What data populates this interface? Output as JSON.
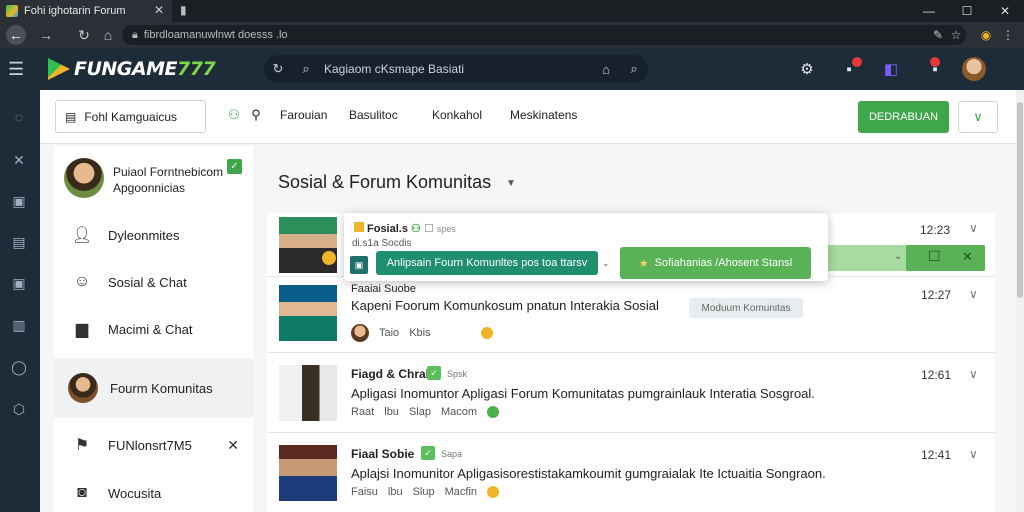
{
  "browser": {
    "tab_title": "Fohi ighotarin Forum",
    "address": "fibrdloamanuwlnwt doesss .lo",
    "new_tab_icon": "plus-icon"
  },
  "app": {
    "logo_prefix": "FUNGAME",
    "logo_suffix": "777",
    "search_placeholder": "Kagiaom cKsmape Basiati"
  },
  "topbar": {
    "category_button": "Fohl Kamguaicus",
    "nav": [
      "Farouian",
      "Basulitoc",
      "Konkahol",
      "Meskinatens"
    ],
    "primary_button": "DEDRABUAN"
  },
  "sidebar": {
    "profile_name": "Puiaol Forntnebicom Apgoonnicias",
    "items": [
      {
        "label": "Dyleonmites"
      },
      {
        "label": "Sosial & Chat"
      },
      {
        "label": "Macimi & Chat"
      },
      {
        "label": "Fourm Komunitas"
      },
      {
        "label": "FUNlonsrt7M5"
      },
      {
        "label": "Wocusita"
      }
    ]
  },
  "content": {
    "title": "Sosial & Forum Komunitas"
  },
  "popup": {
    "title": "Fosial.s",
    "tag": "spes",
    "subtitle": "di.s1a Socdis",
    "button1": "Anlipsain Fourn Komunltes pos toa ttarsv",
    "button2": "Sofiahanias  /Ahosent Stansl"
  },
  "rows": [
    {
      "title": "",
      "tag": "",
      "desc": "",
      "time": "12:23",
      "meta": []
    },
    {
      "title": "Faaiai Suobe",
      "tag": "",
      "desc": "Kapeni Foorum Komunkosum pnatun Interakia Sosial",
      "pill": "Moduum Komunitas",
      "time": "12:27",
      "meta": [
        "Taio",
        "Kbis"
      ]
    },
    {
      "title": "Fiagd & Chral",
      "tag": "Spsk",
      "desc": "Apligasi Inomuntor Apligasi Forum Komunitatas pumgrainlauk Interatia Sosgroal.",
      "time": "12:61",
      "meta": [
        "Raat",
        "lbu",
        "Slap",
        "Macom"
      ]
    },
    {
      "title": "Fiaal Sobie",
      "tag": "Sapa",
      "desc": "Aplajsi Inomunitor Apligasisorestistakamkoumit gumgraialak Ite Ictuaitia Songraon.",
      "time": "12:41",
      "meta": [
        "Faisu",
        "lbu",
        "Slup",
        "Macfin"
      ]
    }
  ]
}
